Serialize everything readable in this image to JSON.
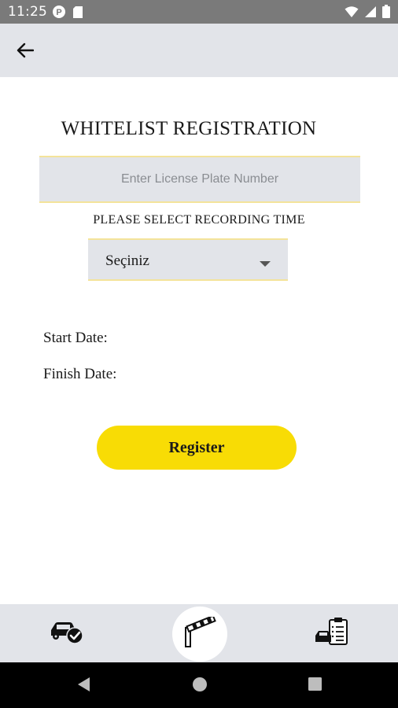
{
  "status_bar": {
    "time": "11:25",
    "icons": [
      "notification-app-icon",
      "sd-card-icon",
      "wifi-icon",
      "signal-icon",
      "battery-icon"
    ]
  },
  "app_bar": {
    "back_icon": "arrow-left-icon"
  },
  "form": {
    "title": "WHITELIST REGISTRATION",
    "plate_input": {
      "value": "",
      "placeholder": "Enter License Plate Number"
    },
    "recording_label": "PLEASE SELECT RECORDING TIME",
    "recording_select": {
      "selected": "Seçiniz"
    },
    "start_date_label": "Start Date:",
    "finish_date_label": "Finish Date:",
    "register_label": "Register"
  },
  "bottom_nav": {
    "items": [
      {
        "icon": "car-check-icon"
      },
      {
        "icon": "barrier-gate-icon",
        "active": true
      },
      {
        "icon": "car-clipboard-icon"
      }
    ]
  },
  "system_nav": {
    "buttons": [
      "back-triangle-icon",
      "home-circle-icon",
      "recents-square-icon"
    ]
  },
  "colors": {
    "accent": "#f8dc05",
    "field_background": "#e2e4e9",
    "field_border": "#f4e39a",
    "status_bar": "#7a7a7a"
  }
}
